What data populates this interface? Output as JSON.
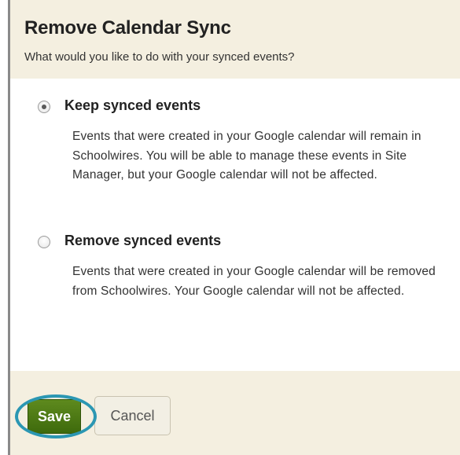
{
  "dialog": {
    "title": "Remove Calendar Sync",
    "subtitle": "What would you like to do with your synced events?"
  },
  "options": [
    {
      "label": "Keep synced events",
      "selected": true,
      "description": "Events that were created in your Google calendar will remain in Schoolwires. You will be able to manage these events in Site Manager, but your Google calendar will not be affected."
    },
    {
      "label": "Remove synced events",
      "selected": false,
      "description": "Events that were created in your Google calendar will be removed from Schoolwires. Your Google calendar will not be affected."
    }
  ],
  "footer": {
    "save_label": "Save",
    "cancel_label": "Cancel"
  },
  "colors": {
    "panel_background": "#f4efe0",
    "save_button": "#4e7a14",
    "highlight_ring": "#2b97b3"
  }
}
